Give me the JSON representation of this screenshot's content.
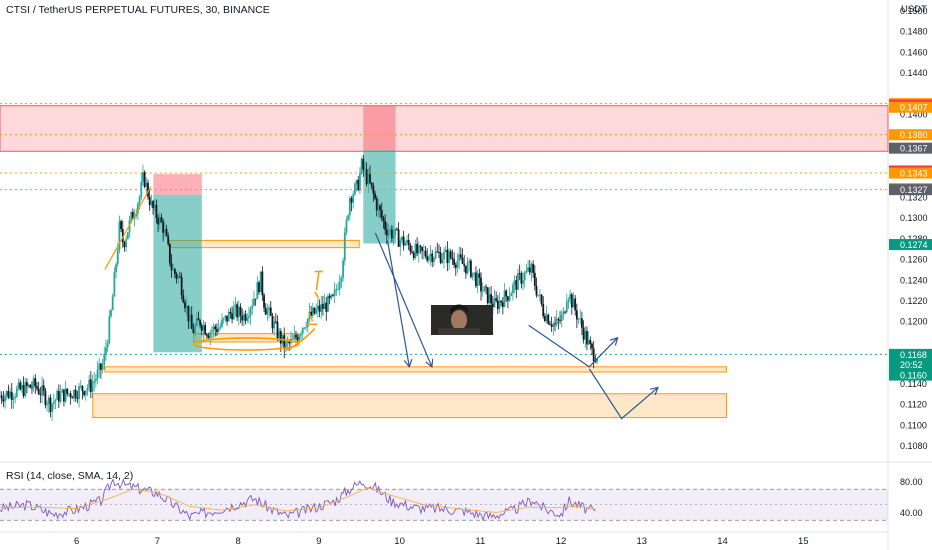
{
  "header": {
    "title": "CTSI / TetherUS PERPETUAL FUTURES, 30, BINANCE",
    "currency": "USDT"
  },
  "rsi": {
    "label": "RSI (14, close, SMA, 14, 2)",
    "ticks": [
      "80.00",
      "40.00"
    ]
  },
  "colors": {
    "up": "#26a69a",
    "down": "#131722",
    "zone_red": "#f7525f",
    "zone_orange": "#ff9800",
    "arrow": "#2a5599",
    "rsi": "#7e57c2",
    "rsi_ma": "#f5b342"
  },
  "chart_data": {
    "type": "candlestick",
    "title": "CTSI / TetherUS PERPETUAL FUTURES, 30, BINANCE",
    "xlabel": "",
    "ylabel": "USDT",
    "ylim": [
      0.1068,
      0.151
    ],
    "y_ticks": [
      "0.1500",
      "0.1480",
      "0.1460",
      "0.1440",
      "0.1400",
      "0.1320",
      "0.1300",
      "0.1280",
      "0.1260",
      "0.1240",
      "0.1220",
      "0.1200",
      "0.1140",
      "0.1120",
      "0.1100",
      "0.1080"
    ],
    "x_ticks": [
      {
        "label": "6",
        "day": 6
      },
      {
        "label": "7",
        "day": 7
      },
      {
        "label": "8",
        "day": 8
      },
      {
        "label": "9",
        "day": 9
      },
      {
        "label": "10",
        "day": 10
      },
      {
        "label": "11",
        "day": 11
      },
      {
        "label": "12",
        "day": 12
      },
      {
        "label": "13",
        "day": 13
      },
      {
        "label": "14",
        "day": 14
      },
      {
        "label": "15",
        "day": 15
      }
    ],
    "xlim_days": [
      5.05,
      16.05
    ],
    "price_path": [
      [
        5.05,
        0.1128
      ],
      [
        5.3,
        0.1133
      ],
      [
        5.5,
        0.1138
      ],
      [
        5.6,
        0.113
      ],
      [
        5.7,
        0.112
      ],
      [
        5.8,
        0.1128
      ],
      [
        6.0,
        0.1132
      ],
      [
        6.2,
        0.1138
      ],
      [
        6.35,
        0.1158
      ],
      [
        6.45,
        0.121
      ],
      [
        6.55,
        0.129
      ],
      [
        6.6,
        0.1275
      ],
      [
        6.7,
        0.13
      ],
      [
        6.8,
        0.132
      ],
      [
        6.85,
        0.134
      ],
      [
        6.95,
        0.131
      ],
      [
        7.1,
        0.129
      ],
      [
        7.2,
        0.125
      ],
      [
        7.3,
        0.124
      ],
      [
        7.45,
        0.119
      ],
      [
        7.55,
        0.12
      ],
      [
        7.65,
        0.119
      ],
      [
        7.8,
        0.1195
      ],
      [
        7.95,
        0.121
      ],
      [
        8.1,
        0.1205
      ],
      [
        8.2,
        0.122
      ],
      [
        8.3,
        0.124
      ],
      [
        8.35,
        0.1215
      ],
      [
        8.5,
        0.119
      ],
      [
        8.6,
        0.1175
      ],
      [
        8.7,
        0.118
      ],
      [
        8.85,
        0.12
      ],
      [
        9.0,
        0.121
      ],
      [
        9.2,
        0.122
      ],
      [
        9.3,
        0.125
      ],
      [
        9.4,
        0.132
      ],
      [
        9.5,
        0.133
      ],
      [
        9.55,
        0.135
      ],
      [
        9.65,
        0.1332
      ],
      [
        9.75,
        0.131
      ],
      [
        9.85,
        0.129
      ],
      [
        10.0,
        0.128
      ],
      [
        10.1,
        0.1275
      ],
      [
        10.25,
        0.1265
      ],
      [
        10.45,
        0.1265
      ],
      [
        10.65,
        0.1262
      ],
      [
        10.75,
        0.1258
      ],
      [
        10.9,
        0.125
      ],
      [
        11.05,
        0.123
      ],
      [
        11.2,
        0.1215
      ],
      [
        11.35,
        0.1225
      ],
      [
        11.5,
        0.124
      ],
      [
        11.65,
        0.125
      ],
      [
        11.7,
        0.1235
      ],
      [
        11.8,
        0.121
      ],
      [
        11.95,
        0.1195
      ],
      [
        12.05,
        0.1205
      ],
      [
        12.1,
        0.123
      ],
      [
        12.2,
        0.121
      ],
      [
        12.3,
        0.119
      ],
      [
        12.4,
        0.117
      ],
      [
        12.45,
        0.1168
      ]
    ],
    "horizontal_levels": [
      {
        "price": 0.141,
        "kind": "dotted",
        "color": "#ff9800"
      },
      {
        "price": 0.138,
        "kind": "dotted",
        "color": "#ff9800"
      },
      {
        "price": 0.1343,
        "kind": "dotted",
        "color": "#ff9800"
      },
      {
        "price": 0.1327,
        "kind": "dotted",
        "color": "#ff9800"
      },
      {
        "price": 0.1168,
        "kind": "dotted",
        "color": "#26a69a"
      }
    ],
    "zones": [
      {
        "kind": "red",
        "price_top": 0.1408,
        "price_bottom": 0.1364,
        "day_start": 5.05,
        "day_end": 16.05
      },
      {
        "kind": "orange",
        "price_top": 0.1278,
        "price_bottom": 0.1271,
        "day_start": 7.15,
        "day_end": 9.5
      },
      {
        "kind": "orange",
        "price_top": 0.1188,
        "price_bottom": 0.118,
        "day_start": 7.45,
        "day_end": 8.75
      },
      {
        "kind": "orange",
        "price_top": 0.1156,
        "price_bottom": 0.1151,
        "day_start": 6.35,
        "day_end": 14.05
      },
      {
        "kind": "orange",
        "price_top": 0.113,
        "price_bottom": 0.1107,
        "day_start": 6.2,
        "day_end": 14.05
      }
    ],
    "positions": [
      {
        "entry": 0.1322,
        "stop": 0.1342,
        "target": 0.117,
        "day_start": 6.95,
        "day_end": 7.55
      },
      {
        "entry": 0.1365,
        "stop": 0.1408,
        "target": 0.1275,
        "day_start": 9.55,
        "day_end": 9.95
      }
    ],
    "price_labels": [
      {
        "text": "0.1410",
        "price": 0.141,
        "bg": "#ff9800"
      },
      {
        "text": "0.1408",
        "price": 0.14085,
        "bg": "#f23645"
      },
      {
        "text": "0.1407",
        "price": 0.14065,
        "bg": "#ff9800"
      },
      {
        "text": "0.1380",
        "price": 0.138,
        "bg": "#ff9800"
      },
      {
        "text": "0.1367",
        "price": 0.1367,
        "bg": "#5d606b"
      },
      {
        "text": "0.1345",
        "price": 0.1345,
        "bg": "#f23645"
      },
      {
        "text": "0.1343",
        "price": 0.1343,
        "bg": "#ff9800"
      },
      {
        "text": "0.1328",
        "price": 0.1328,
        "bg": "#ff9800"
      },
      {
        "text": "0.1327",
        "price": 0.1327,
        "bg": "#5d606b"
      },
      {
        "text": "0.1274",
        "price": 0.1274,
        "bg": "#089981"
      },
      {
        "text": "0.1168",
        "price": 0.1168,
        "bg": "#089981"
      },
      {
        "text": "20:52",
        "price": 0.1158,
        "bg": "#089981"
      },
      {
        "text": "0.1160",
        "price": 0.1148,
        "bg": "#089981"
      }
    ],
    "arrows": [
      [
        [
          9.85,
          0.1278
        ],
        [
          10.12,
          0.1156
        ]
      ],
      [
        [
          9.7,
          0.1285
        ],
        [
          10.4,
          0.1156
        ]
      ],
      [
        [
          11.6,
          0.1196
        ],
        [
          12.35,
          0.1156
        ],
        [
          12.7,
          0.1184
        ]
      ],
      [
        [
          12.35,
          0.1154
        ],
        [
          12.75,
          0.1106
        ],
        [
          13.2,
          0.1136
        ]
      ]
    ],
    "rsi_ylim": [
      20,
      100
    ],
    "rsi_levels": [
      70,
      30
    ],
    "rsi_path": [
      [
        5.05,
        45
      ],
      [
        5.4,
        50
      ],
      [
        5.7,
        38
      ],
      [
        6.0,
        44
      ],
      [
        6.3,
        55
      ],
      [
        6.45,
        82
      ],
      [
        6.6,
        75
      ],
      [
        6.8,
        70
      ],
      [
        7.0,
        65
      ],
      [
        7.2,
        50
      ],
      [
        7.4,
        35
      ],
      [
        7.6,
        40
      ],
      [
        7.9,
        48
      ],
      [
        8.2,
        58
      ],
      [
        8.4,
        45
      ],
      [
        8.6,
        35
      ],
      [
        8.9,
        45
      ],
      [
        9.2,
        55
      ],
      [
        9.4,
        72
      ],
      [
        9.55,
        80
      ],
      [
        9.7,
        72
      ],
      [
        9.9,
        55
      ],
      [
        10.2,
        46
      ],
      [
        10.5,
        45
      ],
      [
        10.8,
        42
      ],
      [
        11.1,
        35
      ],
      [
        11.4,
        42
      ],
      [
        11.65,
        57
      ],
      [
        11.8,
        44
      ],
      [
        12.0,
        38
      ],
      [
        12.1,
        55
      ],
      [
        12.3,
        45
      ],
      [
        12.45,
        40
      ]
    ],
    "rsi_ma_path": [
      [
        5.05,
        46
      ],
      [
        5.5,
        47
      ],
      [
        6.0,
        45
      ],
      [
        6.4,
        58
      ],
      [
        6.7,
        70
      ],
      [
        7.0,
        66
      ],
      [
        7.4,
        48
      ],
      [
        7.8,
        43
      ],
      [
        8.2,
        50
      ],
      [
        8.6,
        42
      ],
      [
        9.0,
        46
      ],
      [
        9.4,
        62
      ],
      [
        9.6,
        72
      ],
      [
        9.9,
        62
      ],
      [
        10.3,
        50
      ],
      [
        10.8,
        44
      ],
      [
        11.2,
        40
      ],
      [
        11.6,
        47
      ],
      [
        11.9,
        46
      ],
      [
        12.2,
        48
      ],
      [
        12.45,
        44
      ]
    ]
  }
}
